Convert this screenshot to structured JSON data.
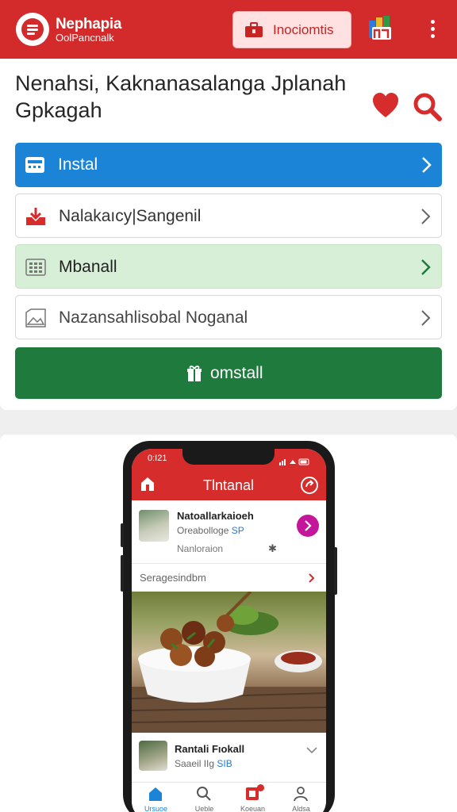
{
  "appbar": {
    "brand_name": "Nephapia",
    "brand_sub": "OolPancnalk",
    "top_button_label": "Inociomtis",
    "icons": [
      "logo-icon",
      "briefcase-icon",
      "app-badge-icon",
      "kebab-menu-icon"
    ]
  },
  "headline": "Nenahsi, Kaknanasalanga Jplanah Gpkagah",
  "rows": [
    {
      "label": "Instal",
      "icon": "calendar-icon"
    },
    {
      "label": "Nalakaıcy|Sangenil",
      "icon": "download-icon"
    },
    {
      "label": "Mbanall",
      "icon": "grid-icon"
    },
    {
      "label": "Nazansahlisobal Noganal",
      "icon": "image-icon"
    }
  ],
  "install_button": {
    "label": "omstall",
    "icon": "gift-icon"
  },
  "colors": {
    "brand_red": "#d32b2b",
    "row_blue": "#1b84d6",
    "row_green_bg": "#d8efd7",
    "install_green": "#1e7a3d",
    "accent_magenta": "#c4169a"
  },
  "phone": {
    "status_time": "0:I21",
    "title": "Tlntanal",
    "item1": {
      "name": "Natoallarkaioeh",
      "sub_text": "Oreabolloge",
      "sub_tag": "SP",
      "meta": "Nanloraion",
      "meta_icon": "✱"
    },
    "link_text": "Seragesindbm",
    "item2": {
      "name": "Rantali Fıokall",
      "sub_text": "Saaeil IIg",
      "sub_tag": "SIB"
    },
    "tabs": [
      {
        "label": "Ursuoe",
        "icon": "home-icon"
      },
      {
        "label": "Ueble",
        "icon": "search-icon"
      },
      {
        "label": "Koeuan",
        "icon": "grid-icon"
      },
      {
        "label": "Aldsa",
        "icon": "person-icon"
      }
    ]
  }
}
